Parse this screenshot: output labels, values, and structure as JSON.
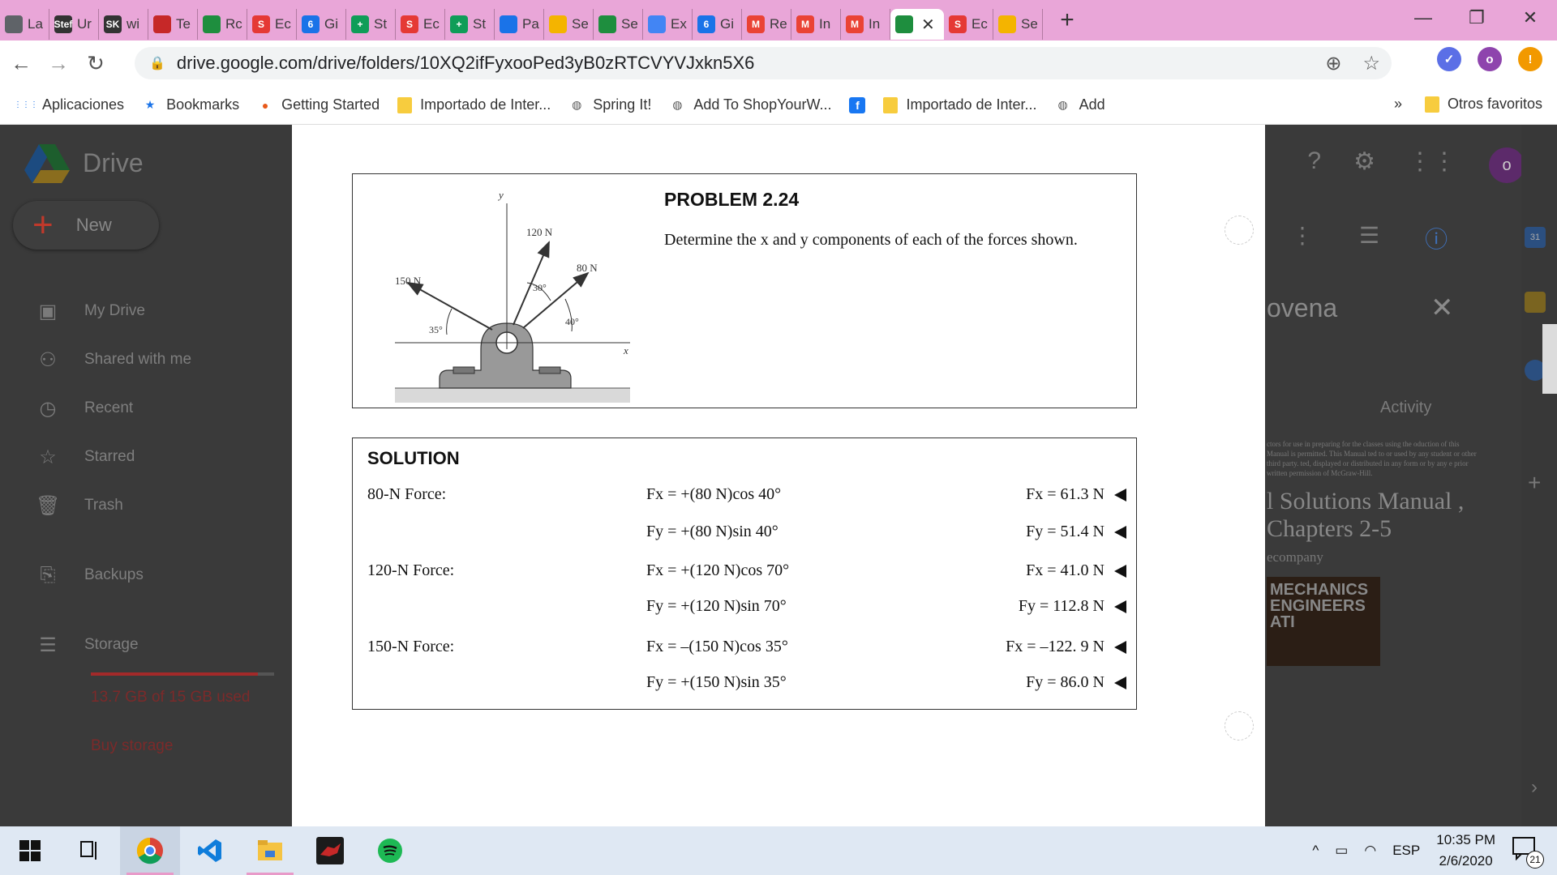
{
  "browser": {
    "tabs": [
      {
        "label": "La",
        "icon": "globe-icon",
        "color": "#5f6368"
      },
      {
        "label": "Ur",
        "icon": "stef-logo-icon",
        "color": "#333333",
        "badge": "Stef"
      },
      {
        "label": "wi",
        "icon": "sk-logo-icon",
        "color": "#333333",
        "badge": "SK"
      },
      {
        "label": "Te",
        "icon": "cards-icon",
        "color": "#c62828"
      },
      {
        "label": "Rc",
        "icon": "drive-icon",
        "color": "#1e8e3e"
      },
      {
        "label": "Ec",
        "icon": "s-icon",
        "color": "#e53935",
        "badge": "S"
      },
      {
        "label": "Gi",
        "icon": "calendar-icon",
        "color": "#1a73e8",
        "badge": "6"
      },
      {
        "label": "St",
        "icon": "sheets-plus-icon",
        "color": "#0f9d58",
        "badge": "+"
      },
      {
        "label": "Ec",
        "icon": "s-icon",
        "color": "#e53935",
        "badge": "S"
      },
      {
        "label": "St",
        "icon": "sheets-plus-icon",
        "color": "#0f9d58",
        "badge": "+"
      },
      {
        "label": "Pa",
        "icon": "dots-icon",
        "color": "#1a73e8"
      },
      {
        "label": "Se",
        "icon": "slides-icon",
        "color": "#f4b400"
      },
      {
        "label": "Se",
        "icon": "drive-icon",
        "color": "#1e8e3e"
      },
      {
        "label": "Ex",
        "icon": "docs-icon",
        "color": "#4285f4"
      },
      {
        "label": "Gi",
        "icon": "calendar-icon",
        "color": "#1a73e8",
        "badge": "6"
      },
      {
        "label": "Re",
        "icon": "gmail-icon",
        "color": "#ea4335",
        "badge": "M"
      },
      {
        "label": "In",
        "icon": "gmail-icon",
        "color": "#ea4335",
        "badge": "M"
      },
      {
        "label": "In",
        "icon": "gmail-icon",
        "color": "#ea4335",
        "badge": "M"
      },
      {
        "label": "",
        "icon": "drive-icon",
        "color": "#1e8e3e",
        "active": true
      },
      {
        "label": "Ec",
        "icon": "s-icon",
        "color": "#e53935",
        "badge": "S"
      },
      {
        "label": "Se",
        "icon": "slides-icon",
        "color": "#f4b400"
      }
    ],
    "new_tab": "+",
    "close_tab": "✕",
    "url": "drive.google.com/drive/folders/10XQ2ifFyxooPed3yB0zRTCVYVJxkn5X6",
    "profile_initial": "o",
    "alert": "!",
    "bookmarks": [
      {
        "label": "Aplicaciones",
        "icon": "apps-grid-icon"
      },
      {
        "label": "Bookmarks",
        "icon": "star-icon"
      },
      {
        "label": "Getting Started",
        "icon": "firefox-icon"
      },
      {
        "label": "Importado de Inter...",
        "icon": "folder-icon"
      },
      {
        "label": "Spring It!",
        "icon": "globe-icon"
      },
      {
        "label": "Add To ShopYourW...",
        "icon": "globe-icon"
      },
      {
        "label": "",
        "icon": "facebook-icon",
        "badge": "f"
      },
      {
        "label": "Importado de Inter...",
        "icon": "folder-icon"
      },
      {
        "label": "Add",
        "icon": "globe-icon"
      }
    ],
    "bookmarks_more": "»",
    "other_bookmarks": "Otros favoritos"
  },
  "drive": {
    "app_name": "Drive",
    "new_label": "New",
    "nav": [
      {
        "label": "My Drive",
        "icon": "my-drive-icon"
      },
      {
        "label": "Shared with me",
        "icon": "people-icon"
      },
      {
        "label": "Recent",
        "icon": "clock-icon"
      },
      {
        "label": "Starred",
        "icon": "star-outline-icon"
      },
      {
        "label": "Trash",
        "icon": "trash-icon"
      },
      {
        "label": "Backups",
        "icon": "backup-icon"
      },
      {
        "label": "Storage",
        "icon": "storage-icon"
      }
    ],
    "storage_used": "13.7 GB of 15 GB used",
    "storage_fraction": 0.91,
    "buy_storage": "Buy storage",
    "avatar_initial": "o",
    "right_panel": {
      "title_fragment": "ovena",
      "activity": "Activity",
      "book_small_text": "ctors for use in preparing for the classes using the oduction of this Manual is permitted. This Manual ted to or used by any student or other third party. ted, displayed or distributed in any form or by any e prior written permission of McGraw-Hill.",
      "book_title": "l Solutions Manual , Chapters 2-5",
      "book_company": "ecompany",
      "book_cover": "MECHANICS ENGINEERS ATI"
    }
  },
  "document": {
    "problem_title": "PROBLEM 2.24",
    "problem_text": "Determine the x and y components of each of the forces shown.",
    "figure": {
      "axis_y": "y",
      "axis_x": "x",
      "force_120": "120 N",
      "force_80": "80 N",
      "force_150": "150 N",
      "angle_30": "30°",
      "angle_40": "40°",
      "angle_35": "35°"
    },
    "solution_title": "SOLUTION",
    "rows": [
      {
        "label": "80-N Force:",
        "eq": "Fx = +(80 N)cos 40°",
        "res": "Fx = 61.3 N"
      },
      {
        "label": "",
        "eq": "Fy = +(80 N)sin 40°",
        "res": "Fy = 51.4 N"
      },
      {
        "label": "120-N Force:",
        "eq": "Fx = +(120 N)cos 70°",
        "res": "Fx = 41.0 N"
      },
      {
        "label": "",
        "eq": "Fy = +(120 N)sin 70°",
        "res": "Fy = 112.8 N"
      },
      {
        "label": "150-N Force:",
        "eq": "Fx = –(150 N)cos 35°",
        "res": "Fx = –122. 9 N"
      },
      {
        "label": "",
        "eq": "Fy = +(150 N)sin 35°",
        "res": "Fy = 86.0 N"
      }
    ]
  },
  "taskbar": {
    "apps": [
      "windows-start-icon",
      "task-view-icon",
      "chrome-icon",
      "vscode-icon",
      "file-explorer-icon",
      "game-app-icon",
      "spotify-icon"
    ],
    "tray_chevron": "^",
    "language": "ESP",
    "time": "10:35 PM",
    "date": "2/6/2020",
    "notification_count": "21"
  }
}
